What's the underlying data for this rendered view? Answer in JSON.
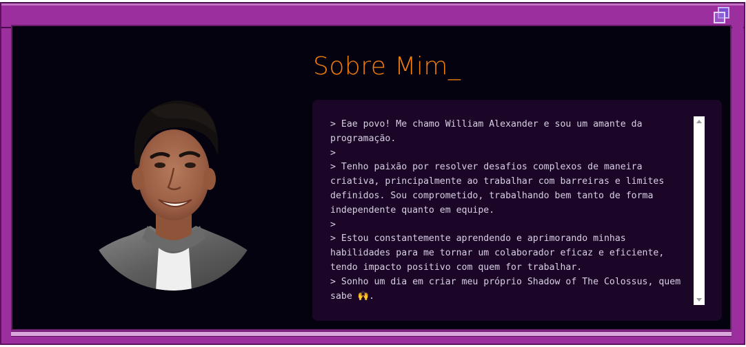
{
  "window": {
    "maximize_icon": "restore-windows-icon",
    "colors": {
      "frame": "#9b2f9d",
      "content_bg": "#05020f",
      "terminal_bg": "#1b0628",
      "heading": "#f07c0e",
      "terminal_text": "#d8cfe4"
    }
  },
  "about": {
    "title": "Sobre Mim",
    "title_cursor": "_",
    "lines": [
      "> Eae povo! Me chamo William Alexander e sou um amante da programação.",
      ">",
      "> Tenho paixão por resolver desafios complexos de maneira criativa, principalmente ao trabalhar com barreiras e limites definidos. Sou comprometido, trabalhando bem tanto de forma independente quanto em equipe.",
      ">",
      "> Estou constantemente aprendendo e aprimorando minhas habilidades para me tornar um colaborador eficaz e eficiente, tendo impacto positivo com quem for trabalhar.",
      "> Sonho um dia em criar meu próprio Shadow of The Colossus, quem sabe 🙌."
    ]
  },
  "profile": {
    "photo_icon": "profile-photo"
  }
}
